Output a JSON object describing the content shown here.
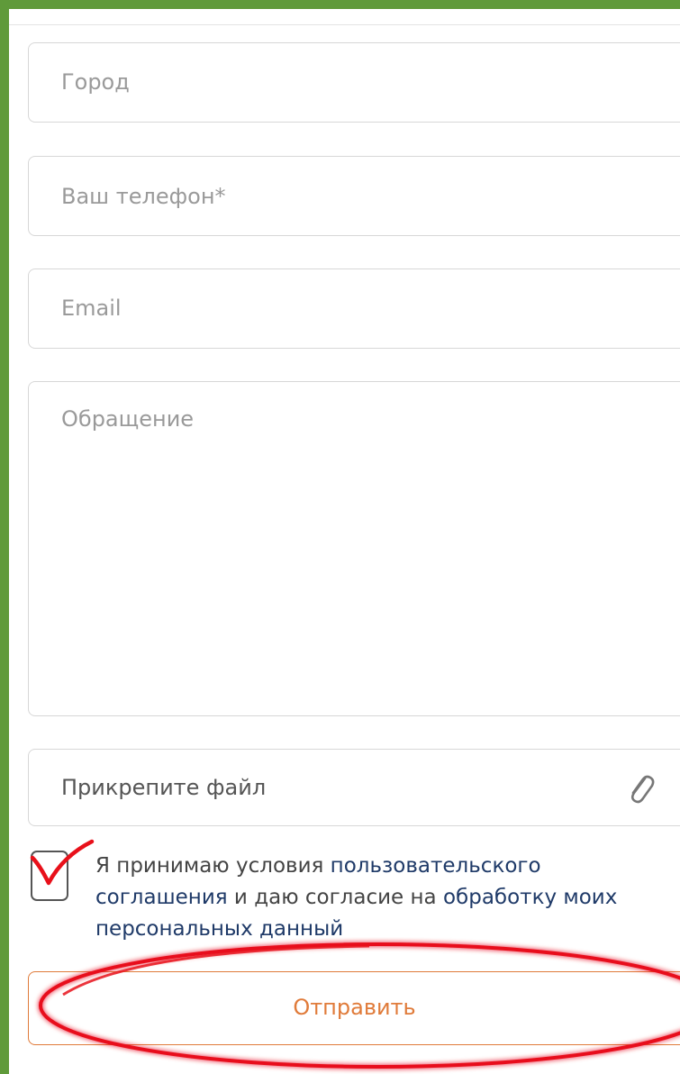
{
  "form": {
    "city_placeholder": "Город",
    "phone_placeholder": "Ваш телефон*",
    "email_placeholder": "Email",
    "message_placeholder": "Обращение",
    "file_label": "Прикрепите файл"
  },
  "consent": {
    "checked": true,
    "line1_prefix": "Я принимаю условия ",
    "line1_link": "пользовательского",
    "line2_link": "соглашения",
    "line2_middle": " и даю согласие на ",
    "line2_link2": "обработку моих",
    "line3_link": "персональных данный"
  },
  "submit": {
    "label": "Отправить"
  },
  "icons": {
    "attach": "paperclip-icon",
    "check": "check-mark-icon"
  },
  "colors": {
    "frame": "#5f9a3a",
    "link": "#1f3a68",
    "accent": "#e07b3a",
    "annotation": "#e8101a"
  }
}
